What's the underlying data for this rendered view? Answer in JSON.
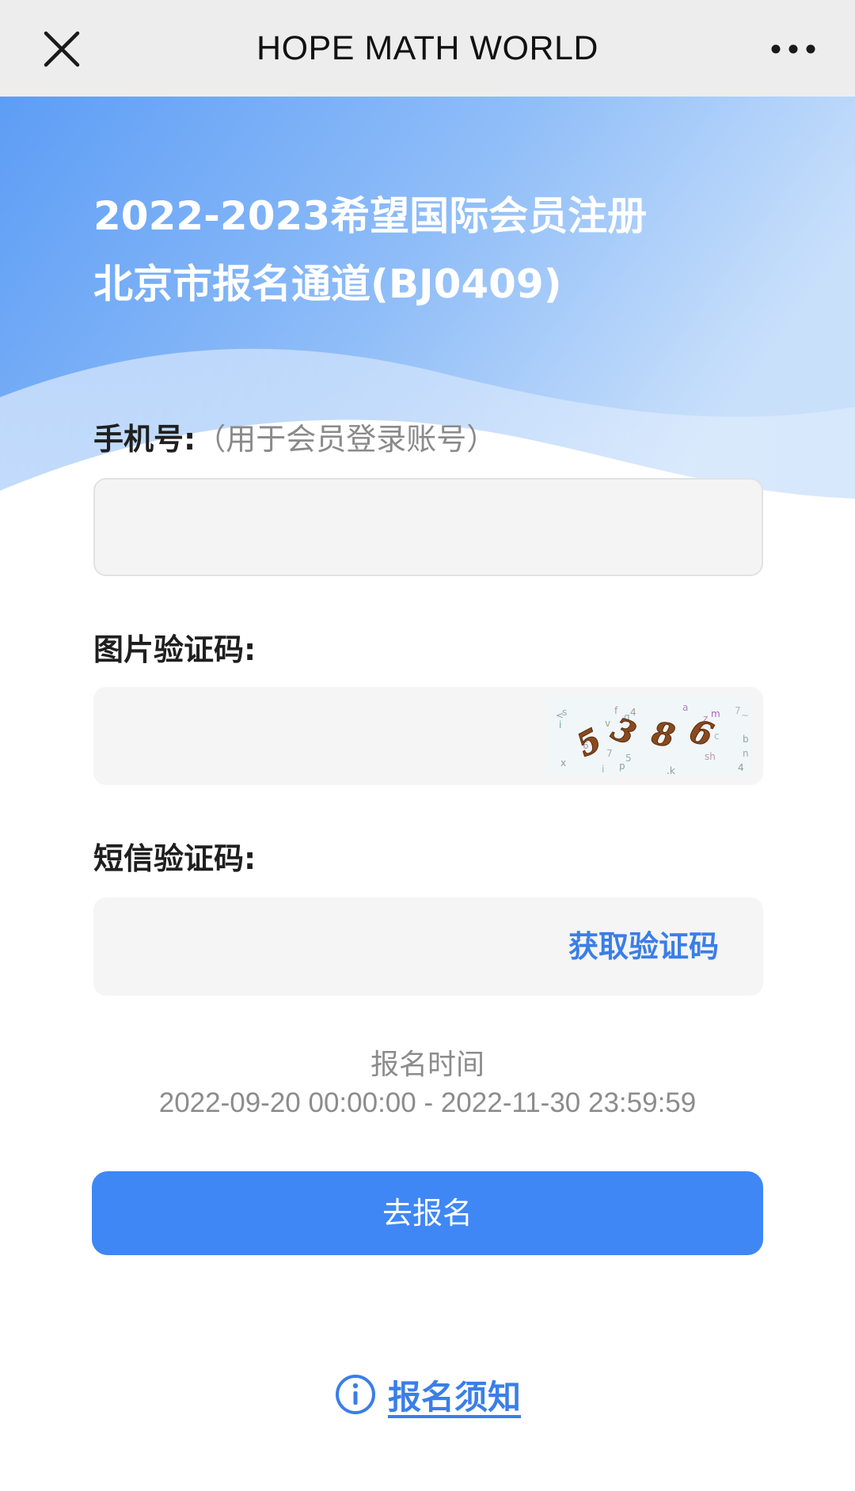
{
  "navbar": {
    "title": "HOPE MATH WORLD",
    "close_icon": "close-icon",
    "more_icon": "more-horizontal-icon"
  },
  "hero": {
    "title_line1": "2022-2023希望国际会员注册",
    "title_line2": "北京市报名通道(BJ0409)"
  },
  "form": {
    "phone": {
      "label": "手机号:",
      "hint": "（用于会员登录账号）",
      "value": ""
    },
    "image_captcha": {
      "label": "图片验证码:",
      "value": "",
      "captcha_text": "5386"
    },
    "sms_code": {
      "label": "短信验证码:",
      "value": "",
      "get_code_label": "获取验证码"
    }
  },
  "registration": {
    "time_label": "报名时间",
    "time_range": "2022-09-20 00:00:00 - 2022-11-30 23:59:59"
  },
  "submit_label": "去报名",
  "notice": {
    "icon": "info-circle-icon",
    "link_label": "报名须知"
  },
  "colors": {
    "accent": "#3f87f5",
    "link": "#3a7ee8",
    "navbar_bg": "#ededed",
    "hero_blue_dark": "#5f9ff5",
    "hero_blue_light": "#cfe3fb"
  }
}
